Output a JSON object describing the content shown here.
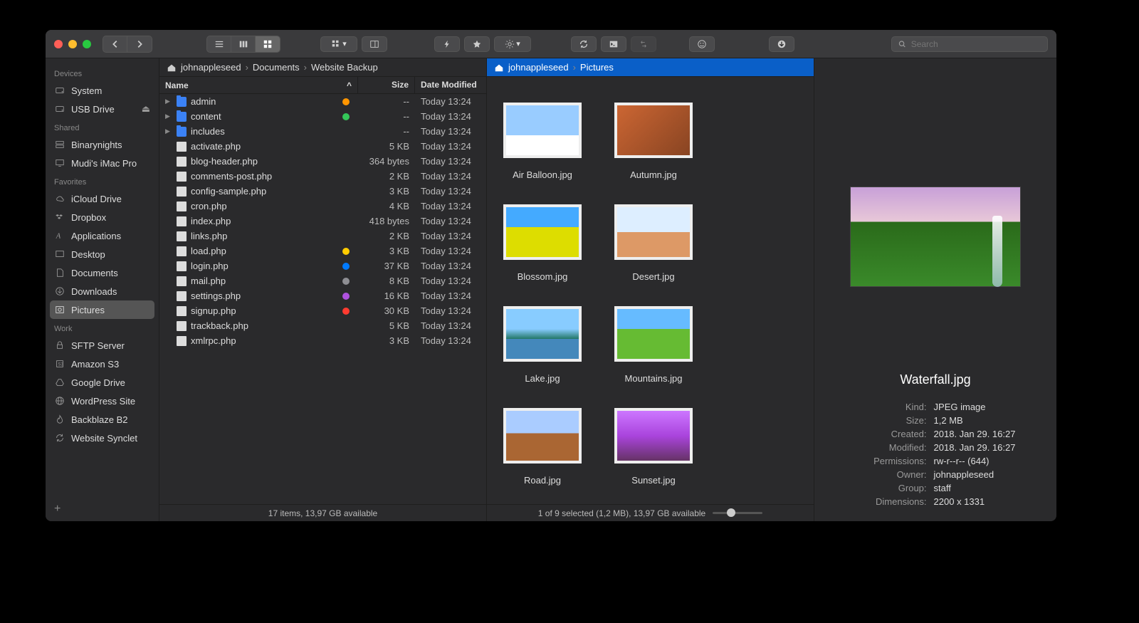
{
  "search": {
    "placeholder": "Search"
  },
  "sidebar": {
    "sections": [
      {
        "title": "Devices",
        "items": [
          {
            "icon": "disk-icon",
            "label": "System"
          },
          {
            "icon": "disk-icon",
            "label": "USB Drive",
            "eject": true
          }
        ]
      },
      {
        "title": "Shared",
        "items": [
          {
            "icon": "server-icon",
            "label": "Binarynights"
          },
          {
            "icon": "imac-icon",
            "label": "Mudi's iMac Pro"
          }
        ]
      },
      {
        "title": "Favorites",
        "items": [
          {
            "icon": "cloud-icon",
            "label": "iCloud Drive"
          },
          {
            "icon": "dropbox-icon",
            "label": "Dropbox"
          },
          {
            "icon": "apps-icon",
            "label": "Applications"
          },
          {
            "icon": "desktop-icon",
            "label": "Desktop"
          },
          {
            "icon": "documents-icon",
            "label": "Documents"
          },
          {
            "icon": "downloads-icon",
            "label": "Downloads"
          },
          {
            "icon": "pictures-icon",
            "label": "Pictures",
            "active": true
          }
        ]
      },
      {
        "title": "Work",
        "items": [
          {
            "icon": "lock-icon",
            "label": "SFTP Server"
          },
          {
            "icon": "s3-icon",
            "label": "Amazon S3"
          },
          {
            "icon": "gdrive-icon",
            "label": "Google Drive"
          },
          {
            "icon": "globe-icon",
            "label": "WordPress Site"
          },
          {
            "icon": "flame-icon",
            "label": "Backblaze B2"
          },
          {
            "icon": "sync-icon",
            "label": "Website Synclet"
          }
        ]
      }
    ]
  },
  "leftPane": {
    "crumbs": [
      "johnappleseed",
      "Documents",
      "Website Backup"
    ],
    "columns": {
      "name": "Name",
      "size": "Size",
      "date": "Date Modified"
    },
    "files": [
      {
        "name": "admin",
        "type": "folder",
        "size": "--",
        "date": "Today 13:24",
        "tag": "#ff9500"
      },
      {
        "name": "content",
        "type": "folder",
        "size": "--",
        "date": "Today 13:24",
        "tag": "#34c759"
      },
      {
        "name": "includes",
        "type": "folder",
        "size": "--",
        "date": "Today 13:24"
      },
      {
        "name": "activate.php",
        "type": "file",
        "size": "5 KB",
        "date": "Today 13:24"
      },
      {
        "name": "blog-header.php",
        "type": "file",
        "size": "364 bytes",
        "date": "Today 13:24"
      },
      {
        "name": "comments-post.php",
        "type": "file",
        "size": "2 KB",
        "date": "Today 13:24"
      },
      {
        "name": "config-sample.php",
        "type": "file",
        "size": "3 KB",
        "date": "Today 13:24"
      },
      {
        "name": "cron.php",
        "type": "file",
        "size": "4 KB",
        "date": "Today 13:24"
      },
      {
        "name": "index.php",
        "type": "file",
        "size": "418 bytes",
        "date": "Today 13:24"
      },
      {
        "name": "links.php",
        "type": "file",
        "size": "2 KB",
        "date": "Today 13:24"
      },
      {
        "name": "load.php",
        "type": "file",
        "size": "3 KB",
        "date": "Today 13:24",
        "tag": "#ffcc00"
      },
      {
        "name": "login.php",
        "type": "file",
        "size": "37 KB",
        "date": "Today 13:24",
        "tag": "#007aff"
      },
      {
        "name": "mail.php",
        "type": "file",
        "size": "8 KB",
        "date": "Today 13:24",
        "tag": "#8e8e93"
      },
      {
        "name": "settings.php",
        "type": "file",
        "size": "16 KB",
        "date": "Today 13:24",
        "tag": "#af52de"
      },
      {
        "name": "signup.php",
        "type": "file",
        "size": "30 KB",
        "date": "Today 13:24",
        "tag": "#ff3b30"
      },
      {
        "name": "trackback.php",
        "type": "file",
        "size": "5 KB",
        "date": "Today 13:24"
      },
      {
        "name": "xmlrpc.php",
        "type": "file",
        "size": "3 KB",
        "date": "Today 13:24"
      }
    ],
    "status": "17 items, 13,97 GB available"
  },
  "rightPane": {
    "crumbs": [
      "johnappleseed",
      "Pictures"
    ],
    "thumbs": [
      {
        "label": "Air Balloon.jpg",
        "cls": "th-balloon"
      },
      {
        "label": "Autumn.jpg",
        "cls": "th-autumn"
      },
      {
        "label": "Blossom.jpg",
        "cls": "th-blossom"
      },
      {
        "label": "Desert.jpg",
        "cls": "th-desert"
      },
      {
        "label": "Lake.jpg",
        "cls": "th-lake"
      },
      {
        "label": "Mountains.jpg",
        "cls": "th-mountains"
      },
      {
        "label": "Road.jpg",
        "cls": "th-road"
      },
      {
        "label": "Sunset.jpg",
        "cls": "th-sunset"
      },
      {
        "label": "Waterfall.jpg",
        "cls": "th-waterfall",
        "selected": true
      }
    ],
    "status": "1 of 9 selected (1,2 MB), 13,97 GB available"
  },
  "preview": {
    "title": "Waterfall.jpg",
    "meta": [
      {
        "k": "Kind:",
        "v": "JPEG image"
      },
      {
        "k": "Size:",
        "v": "1,2 MB"
      },
      {
        "k": "Created:",
        "v": "2018. Jan 29. 16:27"
      },
      {
        "k": "Modified:",
        "v": "2018. Jan 29. 16:27"
      },
      {
        "k": "Permissions:",
        "v": "rw-r--r-- (644)"
      },
      {
        "k": "Owner:",
        "v": "johnappleseed"
      },
      {
        "k": "Group:",
        "v": "staff"
      },
      {
        "k": "Dimensions:",
        "v": "2200 x 1331"
      }
    ]
  }
}
